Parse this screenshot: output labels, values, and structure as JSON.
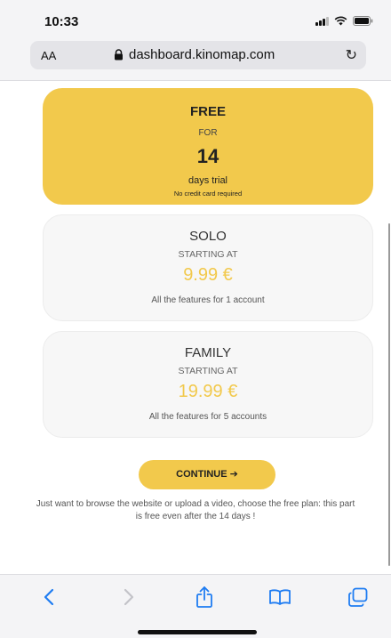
{
  "status_bar": {
    "time": "10:33"
  },
  "browser": {
    "text_size_label": "AA",
    "url": "dashboard.kinomap.com"
  },
  "plans": {
    "free": {
      "name": "FREE",
      "for_label": "FOR",
      "days": "14",
      "trial_label": "days trial",
      "note": "No credit card required"
    },
    "solo": {
      "name": "SOLO",
      "starting_label": "STARTING AT",
      "price": "9.99 €",
      "description": "All the features for 1 account"
    },
    "family": {
      "name": "FAMILY",
      "starting_label": "STARTING AT",
      "price": "19.99 €",
      "description": "All the features for 5 accounts"
    }
  },
  "continue_label": "CONTINUE ➔",
  "footnote": "Just want to browse the website or upload a video, choose the free plan: this part is free even after the 14 days !",
  "toolbar_icons": [
    "back-icon",
    "forward-icon",
    "share-icon",
    "bookmarks-icon",
    "tabs-icon"
  ],
  "colors": {
    "accent": "#f2c94c",
    "card_background": "#f7f7f7",
    "ios_blue": "#1e7cf2"
  }
}
